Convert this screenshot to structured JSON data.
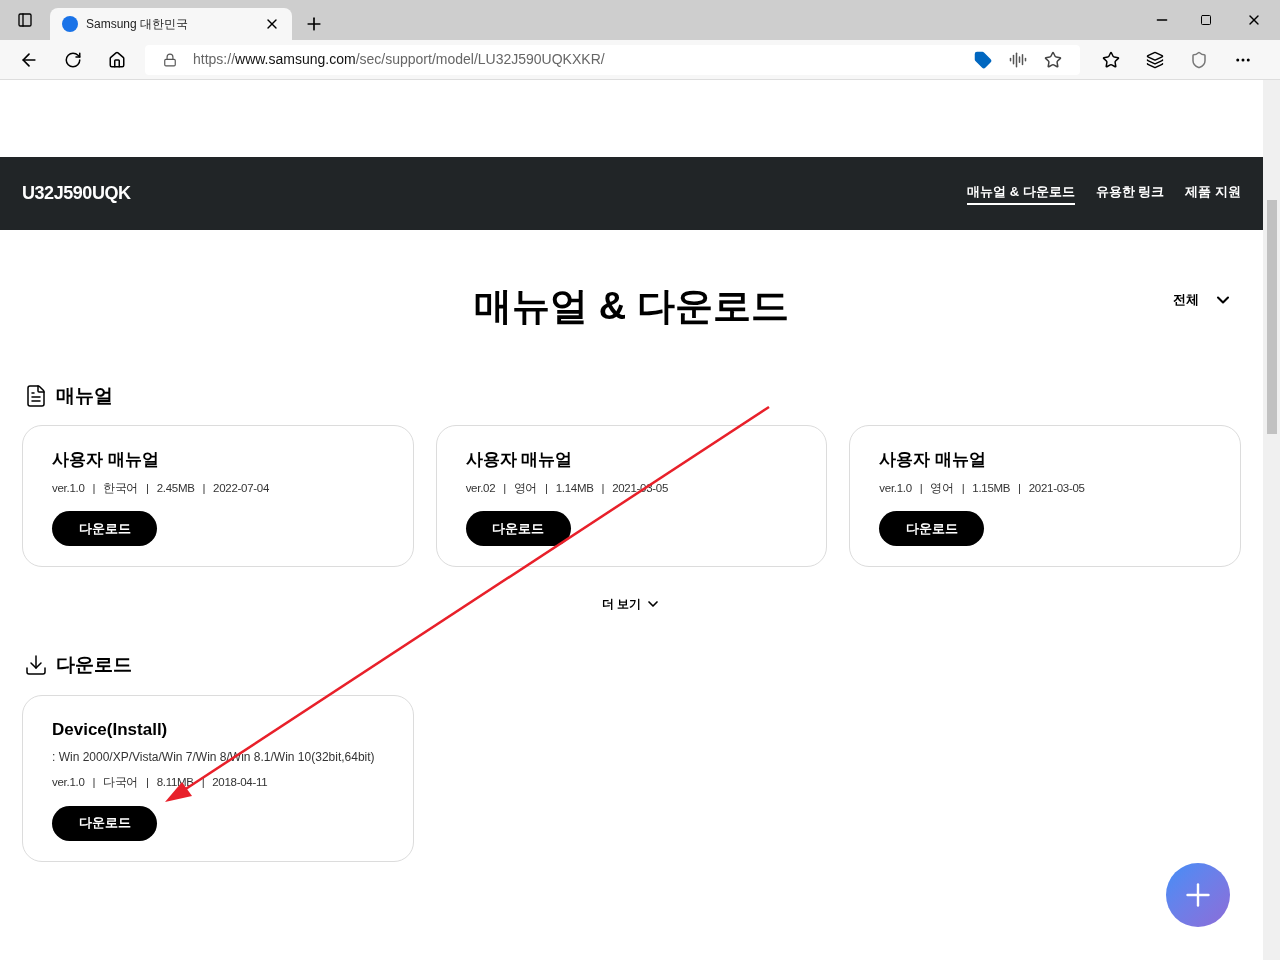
{
  "browser": {
    "tabs": [
      {
        "title": "Samsung 대한민국",
        "selected": true
      }
    ],
    "url": {
      "host_prefix": "https://",
      "host": "www.samsung.com",
      "path": "/sec/support/model/LU32J590UQKXKR/"
    }
  },
  "header": {
    "model": "U32J590UQK",
    "nav": [
      {
        "label": "매뉴얼 & 다운로드",
        "selected": true
      },
      {
        "label": "유용한 링크",
        "selected": false
      },
      {
        "label": "제품 지원",
        "selected": false
      }
    ]
  },
  "page_title": "매뉴얼 & 다운로드",
  "filter": {
    "label": "전체"
  },
  "manuals": {
    "title": "매뉴얼",
    "items": [
      {
        "name": "사용자 매뉴얼",
        "meta": "ver.1.0 | 한국어 | 2.45MB | 2022-07-04",
        "button": "다운로드"
      },
      {
        "name": "사용자 매뉴얼",
        "meta": "ver.02 | 영어 | 1.14MB | 2021-03-05",
        "button": "다운로드"
      },
      {
        "name": "사용자 매뉴얼",
        "meta": "ver.1.0 | 영어 | 1.15MB | 2021-03-05",
        "button": "다운로드"
      }
    ],
    "more": "더 보기"
  },
  "downloads": {
    "title": "다운로드",
    "items": [
      {
        "name": "Device(Install)",
        "os": ": Win 2000/XP/Vista/Win 7/Win 8/Win 8.1/Win 10(32bit,64bit)",
        "meta": "ver.1.0 | 다국어 | 8.11MB | 2018-04-11",
        "button": "다운로드"
      }
    ]
  }
}
